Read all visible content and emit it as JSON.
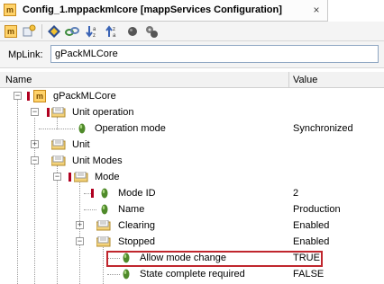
{
  "tab": {
    "title": "Config_1.mppackmlcore [mappServices Configuration]",
    "close_glyph": "×",
    "icon": "mapp-core-icon"
  },
  "toolbar": {
    "buttons": [
      {
        "name": "mapp-core-icon"
      },
      {
        "name": "add-object-icon"
      },
      {
        "name": "navigate-icon"
      },
      {
        "name": "link-icon"
      },
      {
        "name": "sort-descending-icon"
      },
      {
        "name": "sort-ascending-icon"
      },
      {
        "name": "record-icon"
      },
      {
        "name": "settings-icon"
      }
    ]
  },
  "mplink": {
    "label": "MpLink:",
    "value": "gPackMLCore"
  },
  "columns": {
    "name": "Name",
    "value": "Value"
  },
  "tree": {
    "rows": [
      {
        "label": "gPackMLCore",
        "value": ""
      },
      {
        "label": "Unit operation",
        "value": ""
      },
      {
        "label": "Operation mode",
        "value": "Synchronized"
      },
      {
        "label": "Unit",
        "value": ""
      },
      {
        "label": "Unit Modes",
        "value": ""
      },
      {
        "label": "Mode",
        "value": ""
      },
      {
        "label": "Mode ID",
        "value": "2"
      },
      {
        "label": "Name",
        "value": "Production"
      },
      {
        "label": "Clearing",
        "value": "Enabled"
      },
      {
        "label": "Stopped",
        "value": "Enabled"
      },
      {
        "label": "Allow mode change",
        "value": "TRUE"
      },
      {
        "label": "State complete required",
        "value": "FALSE"
      }
    ]
  },
  "colors": {
    "highlight_border": "#c0262d",
    "param_green": "#4f8a2a",
    "required_marker": "#b00020"
  }
}
